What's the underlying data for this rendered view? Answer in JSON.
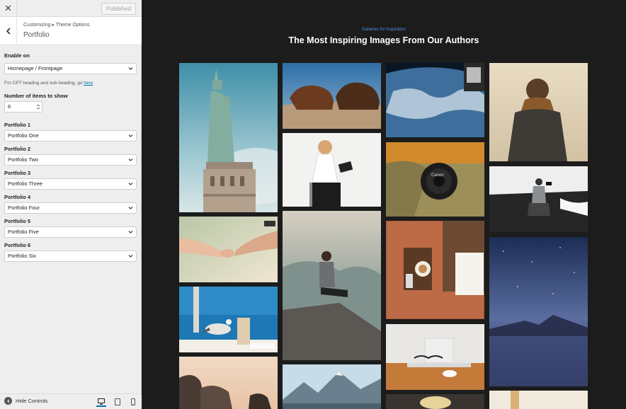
{
  "topbar": {
    "close_glyph": "✕",
    "published_label": "Published"
  },
  "section": {
    "breadcrumb": "Customizing ▸ Theme Options",
    "title": "Portfolio"
  },
  "enable_on": {
    "label": "Enable on",
    "value": "Homepage / Frontpage"
  },
  "cpt_note": {
    "text": "For CPT heading and sub-heading, go ",
    "link": "here"
  },
  "items_count": {
    "label": "Number of items to show",
    "value": "6"
  },
  "portfolios": [
    {
      "label": "Portfolio 1",
      "value": "Portfolio One"
    },
    {
      "label": "Portfolio 2",
      "value": "Portfolio Two"
    },
    {
      "label": "Portfolio 3",
      "value": "Portfolio Three"
    },
    {
      "label": "Portfolio 4",
      "value": "Portfolio Four"
    },
    {
      "label": "Portfolio 5",
      "value": "Portfolio Five"
    },
    {
      "label": "Portfolio 6",
      "value": "Portfolio Six"
    }
  ],
  "footer": {
    "hide_controls": "Hide Controls",
    "devices": [
      "desktop-icon",
      "tablet-icon",
      "mobile-icon"
    ],
    "active_device": "desktop"
  },
  "preview": {
    "kicker": "Galleries for Inspiration",
    "headline": "The Most Inspiring Images From Our Authors",
    "photo_brand_text": "Canon",
    "gallery": [
      "statue-of-liberty-photo",
      "hands-pinky-promise-photo",
      "seagull-on-beach-photo",
      "coastal-rocks-photo",
      "horses-on-hill-photo",
      "woman-with-tablet-photo",
      "man-on-cliff-photo",
      "mountain-peaks-photo",
      "earth-from-space-photo",
      "canon-camera-lens-photo",
      "coffee-cup-table-photo",
      "laptop-and-glasses-photo",
      "teacup-photo",
      "woman-in-scarf-photo",
      "photographer-on-beach-photo",
      "night-sky-lake-photo",
      "bright-strip-photo"
    ]
  },
  "colors": {
    "accent": "#0073aa",
    "kicker": "#4a90e2",
    "preview_bg": "#1c1c1c",
    "sidebar_bg": "#eeeeee"
  }
}
